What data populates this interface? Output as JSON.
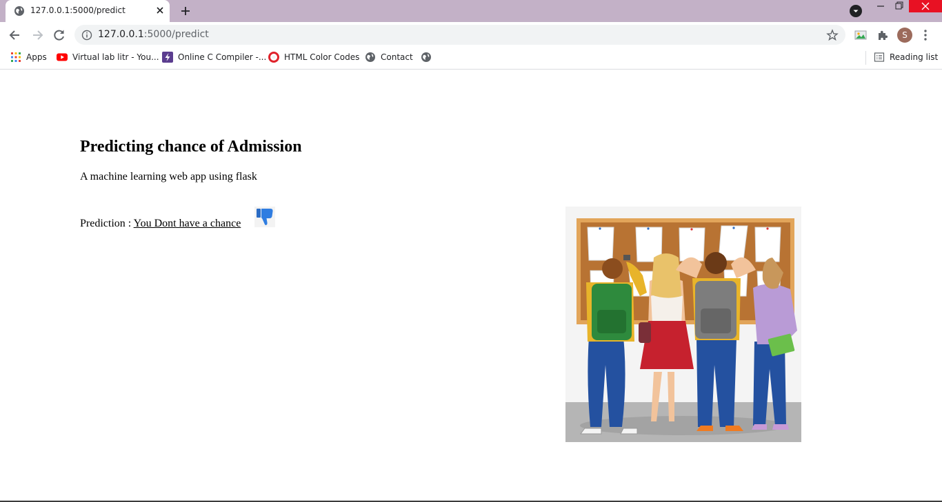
{
  "browser": {
    "tab": {
      "title": "127.0.0.1:5000/predict"
    },
    "address": {
      "host": "127.0.0.1",
      "path": ":5000/predict"
    },
    "profile_initial": "S",
    "bookmarks": [
      {
        "label": "Apps",
        "icon": "apps-grid-icon"
      },
      {
        "label": "Virtual lab litr - You...",
        "icon": "youtube-icon"
      },
      {
        "label": "Online C Compiler -...",
        "icon": "bolt-icon"
      },
      {
        "label": "HTML Color Codes",
        "icon": "opera-icon"
      },
      {
        "label": "Contact",
        "icon": "globe-icon"
      },
      {
        "label": "",
        "icon": "globe-icon"
      }
    ],
    "reading_list": "Reading list",
    "colors": {
      "tabstrip": "#c3b1c7",
      "close_button": "#e81123"
    }
  },
  "page": {
    "title": "Predicting chance of Admission",
    "subtitle": "A machine learning web app using flask",
    "prediction_label": "Prediction : ",
    "prediction_value": "You Dont have a chance",
    "prediction_icon": "thumbs-down-icon",
    "illustration": "students-notice-board-illustration"
  }
}
